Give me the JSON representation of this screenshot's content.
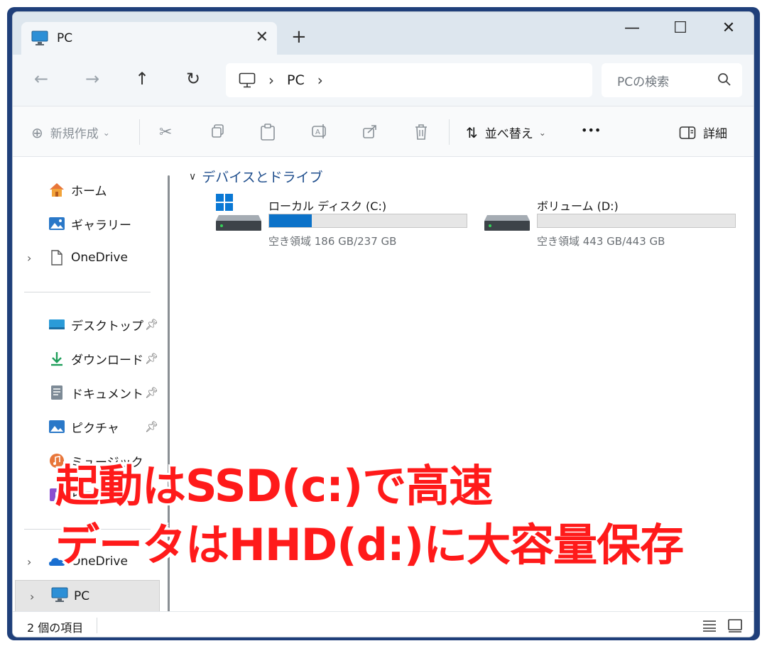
{
  "tab": {
    "title": "PC",
    "icon": "monitor-icon"
  },
  "window_controls": {
    "minimize": "—",
    "maximize": "☐",
    "close": "✕"
  },
  "address": {
    "crumb": "PC",
    "separator": "›"
  },
  "search": {
    "placeholder": "PCの検索"
  },
  "commands": {
    "new": "新規作成",
    "sort": "並べ替え",
    "more": "•••",
    "details": "詳細"
  },
  "nav": {
    "home": "ホーム",
    "gallery": "ギャラリー",
    "onedrive": "OneDrive",
    "desktop": "デスクトップ",
    "downloads": "ダウンロード",
    "documents": "ドキュメント",
    "pictures": "ピクチャ",
    "music": "ミュージック",
    "videos": "ビデオ",
    "onedrive2": "OneDrive",
    "pc": "PC"
  },
  "group": {
    "title": "デバイスとドライブ"
  },
  "drives": [
    {
      "name": "ローカル ディスク (C:)",
      "free": "空き領域 186 GB/237 GB",
      "used_fraction": 0.215,
      "icon": "windows-drive-icon"
    },
    {
      "name": "ボリューム (D:)",
      "free": "空き領域 443 GB/443 GB",
      "used_fraction": 0.0,
      "icon": "hdd-icon"
    }
  ],
  "status": {
    "count": "2 個の項目"
  },
  "overlay": {
    "line1": "起動はSSD(c:)で高速",
    "line2": "データはHHD(d:)に大容量保存"
  },
  "colors": {
    "accent": "#0b72c9",
    "overlay": "#ff1a1a",
    "titlebar": "#dde6ee"
  }
}
